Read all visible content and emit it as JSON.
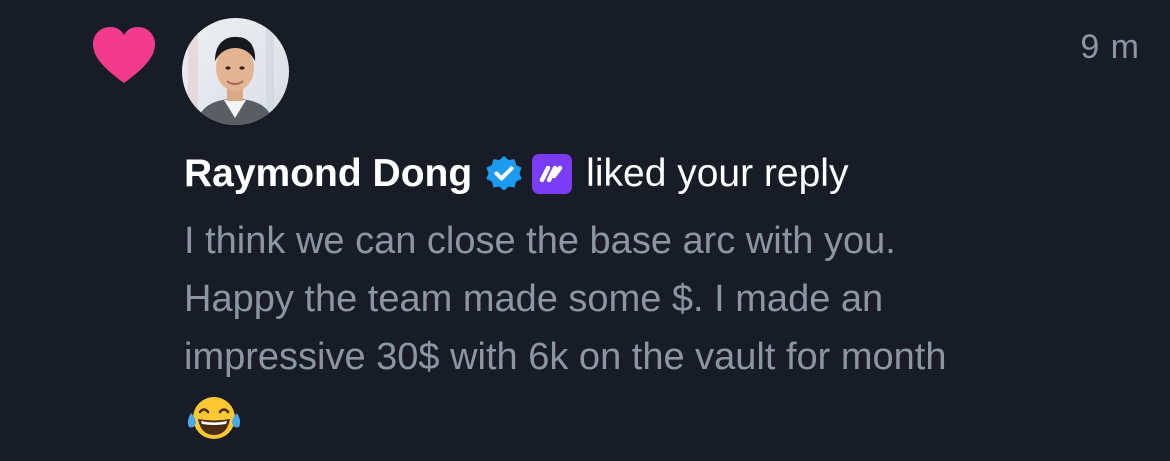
{
  "notification": {
    "type": "like",
    "timestamp": "9 m",
    "user": {
      "name": "Raymond Dong",
      "verified_icon": "verified-badge-icon",
      "affiliate_icon": "affiliate-logo-icon"
    },
    "action_text": "liked your reply",
    "reply": {
      "lines": [
        "I think we can close the base arc with you.",
        "Happy the team made some $. I made an",
        "impressive 30$ with 6k on the vault for month"
      ],
      "emoji": "😂"
    }
  },
  "colors": {
    "background": "#171c27",
    "heart": "#f23b8c",
    "verified": "#1d9bf0",
    "affiliate": "#7a3cf5",
    "secondary_text": "#8b96a3"
  }
}
